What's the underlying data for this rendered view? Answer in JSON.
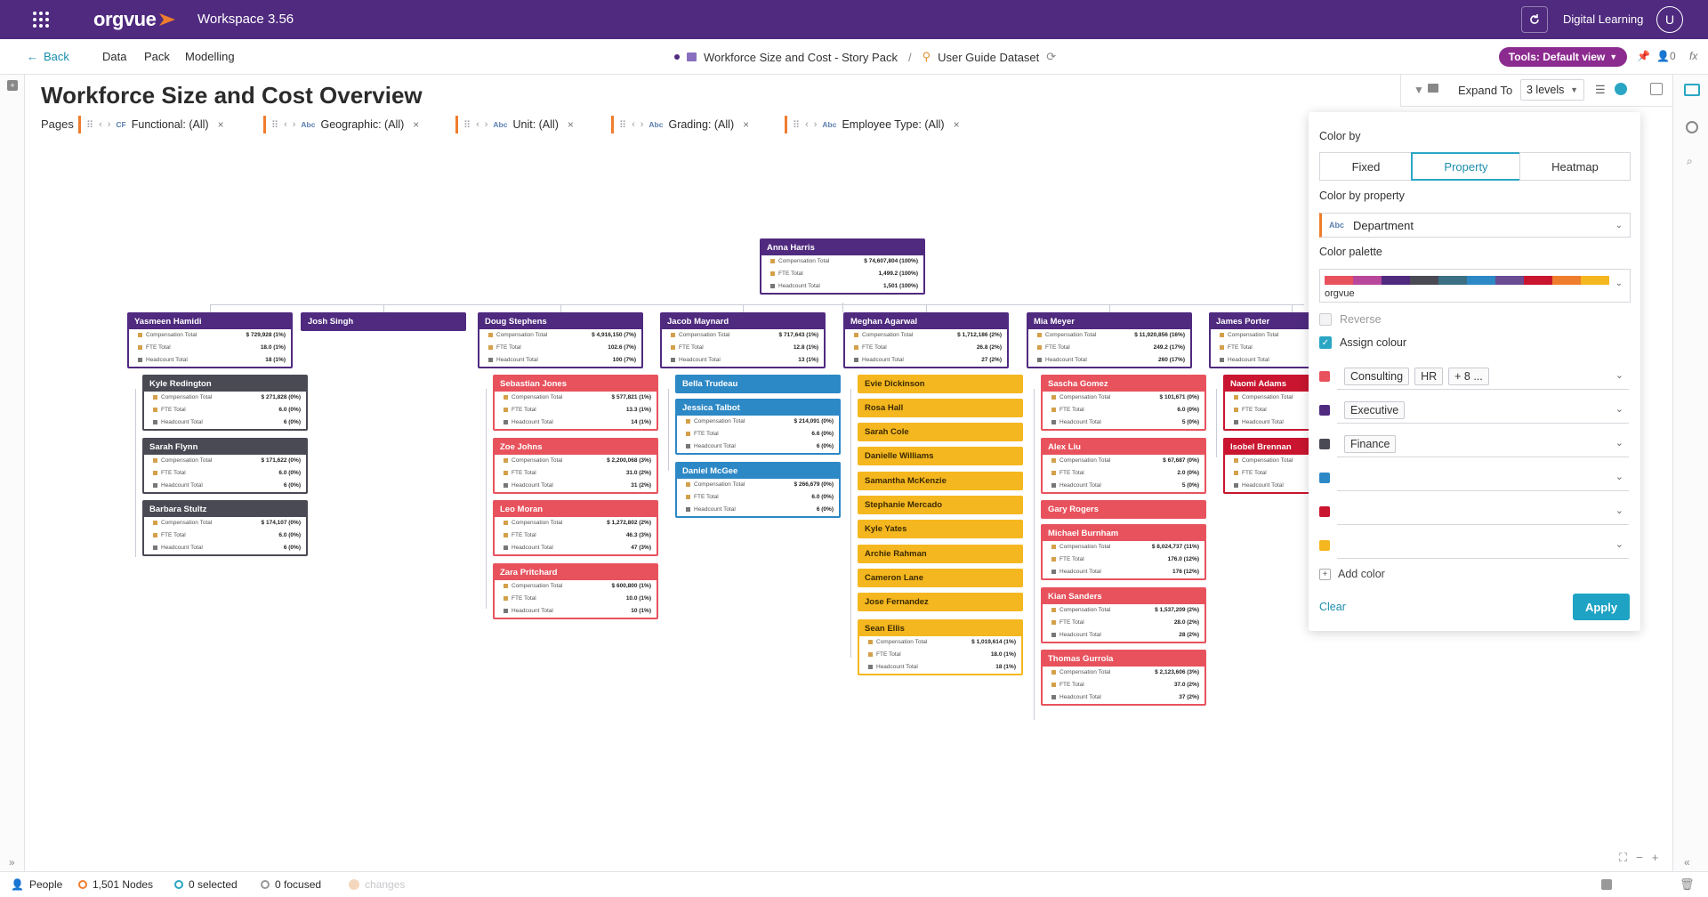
{
  "topbar": {
    "app_name": "orgvue",
    "workspace": "Workspace",
    "version": "3.56",
    "account": "Digital Learning",
    "avatar": "U"
  },
  "nav": {
    "back": "Back",
    "data": "Data",
    "pack": "Pack",
    "modelling": "Modelling",
    "story": "Workforce Size and Cost - Story Pack",
    "sep": "/",
    "dataset": "User Guide Dataset",
    "tools": "Tools: Default view",
    "tools_count": "0"
  },
  "page": {
    "title": "Workforce Size and Cost Overview",
    "pages_label": "Pages"
  },
  "filters": [
    {
      "label": "Functional: (All)",
      "type": "CF"
    },
    {
      "label": "Geographic: (All)",
      "type": "Abc"
    },
    {
      "label": "Unit: (All)",
      "type": "Abc"
    },
    {
      "label": "Grading: (All)",
      "type": "Abc"
    },
    {
      "label": "Employee Type: (All)",
      "type": "Abc"
    }
  ],
  "toolbar": {
    "expand_label": "Expand To",
    "expand_value": "3 levels"
  },
  "metric_labels": {
    "comp": "Compensation Total",
    "fte": "FTE Total",
    "head": "Headcount Total"
  },
  "colors": {
    "purple": "#4f2a7f",
    "red": "#e8525d",
    "yellow": "#f5b71f",
    "blue": "#2d88c6",
    "dark": "#4a4a55",
    "crimson": "#c9152f",
    "accent": "#2aa6c4"
  },
  "nodes": [
    {
      "name": "Anna Harris",
      "color": "purple",
      "comp": "$ 74,607,804 (100%)",
      "fte": "1,499.2 (100%)",
      "head": "1,501 (100%)"
    },
    {
      "name": "Yasmeen Hamidi",
      "color": "purple",
      "comp": "$ 729,928 (1%)",
      "fte": "18.0 (1%)",
      "head": "18 (1%)"
    },
    {
      "name": "Josh Singh",
      "color": "purple"
    },
    {
      "name": "Doug Stephens",
      "color": "purple",
      "comp": "$ 4,916,150 (7%)",
      "fte": "102.6 (7%)",
      "head": "100 (7%)"
    },
    {
      "name": "Jacob Maynard",
      "color": "purple",
      "comp": "$ 717,643 (1%)",
      "fte": "12.8 (1%)",
      "head": "13 (1%)"
    },
    {
      "name": "Meghan Agarwal",
      "color": "purple",
      "comp": "$ 1,712,186 (2%)",
      "fte": "26.8 (2%)",
      "head": "27 (2%)"
    },
    {
      "name": "Mia Meyer",
      "color": "purple",
      "comp": "$ 11,920,856 (16%)",
      "fte": "249.2 (17%)",
      "head": "260 (17%)"
    },
    {
      "name": "James Porter",
      "color": "purple",
      "comp": "",
      "fte": "",
      "head": ""
    },
    {
      "name": "Kyle Redington",
      "color": "dark",
      "comp": "$ 271,828 (0%)",
      "fte": "6.0 (0%)",
      "head": "6 (0%)"
    },
    {
      "name": "Sarah Flynn",
      "color": "dark",
      "comp": "$ 171,622 (0%)",
      "fte": "6.0 (0%)",
      "head": "6 (0%)"
    },
    {
      "name": "Barbara Stultz",
      "color": "dark",
      "comp": "$ 174,107 (0%)",
      "fte": "6.0 (0%)",
      "head": "6 (0%)"
    },
    {
      "name": "Sebastian Jones",
      "color": "red",
      "comp": "$ 577,821 (1%)",
      "fte": "13.3 (1%)",
      "head": "14 (1%)"
    },
    {
      "name": "Zoe Johns",
      "color": "red",
      "comp": "$ 2,200,068 (3%)",
      "fte": "31.0 (2%)",
      "head": "31 (2%)"
    },
    {
      "name": "Leo Moran",
      "color": "red",
      "comp": "$ 1,272,802 (2%)",
      "fte": "46.3 (3%)",
      "head": "47 (3%)"
    },
    {
      "name": "Zara Pritchard",
      "color": "red",
      "comp": "$ 600,800 (1%)",
      "fte": "10.0 (1%)",
      "head": "10 (1%)"
    },
    {
      "name": "Bella Trudeau",
      "color": "blue"
    },
    {
      "name": "Jessica Talbot",
      "color": "blue",
      "comp": "$ 214,091 (0%)",
      "fte": "6.6 (0%)",
      "head": "6 (0%)"
    },
    {
      "name": "Daniel McGee",
      "color": "blue",
      "comp": "$ 266,679 (0%)",
      "fte": "6.0 (0%)",
      "head": "6 (0%)"
    },
    {
      "name": "Evie Dickinson",
      "color": "yellow"
    },
    {
      "name": "Rosa Hall",
      "color": "yellow"
    },
    {
      "name": "Sarah Cole",
      "color": "yellow"
    },
    {
      "name": "Danielle Williams",
      "color": "yellow"
    },
    {
      "name": "Samantha McKenzie",
      "color": "yellow"
    },
    {
      "name": "Stephanie Mercado",
      "color": "yellow"
    },
    {
      "name": "Kyle Yates",
      "color": "yellow"
    },
    {
      "name": "Archie Rahman",
      "color": "yellow"
    },
    {
      "name": "Cameron Lane",
      "color": "yellow"
    },
    {
      "name": "Jose Fernandez",
      "color": "yellow"
    },
    {
      "name": "Sean Ellis",
      "color": "yellow",
      "comp": "$ 1,019,614 (1%)",
      "fte": "18.0 (1%)",
      "head": "18 (1%)"
    },
    {
      "name": "Sascha Gomez",
      "color": "red",
      "comp": "$ 101,671 (0%)",
      "fte": "6.0 (0%)",
      "head": "5 (0%)"
    },
    {
      "name": "Alex Liu",
      "color": "red",
      "comp": "$ 67,687 (0%)",
      "fte": "2.0 (0%)",
      "head": "5 (0%)"
    },
    {
      "name": "Gary Rogers",
      "color": "red"
    },
    {
      "name": "Michael Burnham",
      "color": "red",
      "comp": "$ 8,024,737 (11%)",
      "fte": "176.0 (12%)",
      "head": "176 (12%)"
    },
    {
      "name": "Kian Sanders",
      "color": "red",
      "comp": "$ 1,537,209 (2%)",
      "fte": "28.0 (2%)",
      "head": "28 (2%)"
    },
    {
      "name": "Thomas Gurrola",
      "color": "red",
      "comp": "$ 2,123,606 (3%)",
      "fte": "37.0 (2%)",
      "head": "37 (2%)"
    },
    {
      "name": "Naomi Adams",
      "color": "crimson",
      "comp": "",
      "fte": "",
      "head": ""
    },
    {
      "name": "Isobel Brennan",
      "color": "crimson",
      "comp": "",
      "fte": "",
      "head": ""
    }
  ],
  "panel": {
    "color_by": "Color by",
    "modes": [
      "Fixed",
      "Property",
      "Heatmap"
    ],
    "active_mode": "Property",
    "color_by_property": "Color by property",
    "property_type": "Abc",
    "property": "Department",
    "palette_label": "Color palette",
    "palette_name": "orgvue",
    "palette": [
      "#e8525d",
      "#b8479c",
      "#4f2a7f",
      "#4a4a55",
      "#3b6f84",
      "#2d88c6",
      "#6a4c93",
      "#c9152f",
      "#ef7d2e",
      "#f5b71f"
    ],
    "reverse": "Reverse",
    "assign": "Assign colour",
    "rows": [
      {
        "color": "#e8525d",
        "tags": [
          "Consulting",
          "HR",
          "+ 8 ..."
        ]
      },
      {
        "color": "#4f2a7f",
        "tags": [
          "Executive"
        ]
      },
      {
        "color": "#4a4a55",
        "tags": [
          "Finance"
        ]
      },
      {
        "color": "#2d88c6",
        "tags": []
      },
      {
        "color": "#c9152f",
        "tags": []
      },
      {
        "color": "#f5b71f",
        "tags": []
      }
    ],
    "add_color": "Add color",
    "clear": "Clear",
    "apply": "Apply"
  },
  "status": {
    "dataset": "People",
    "nodes": "1,501 Nodes",
    "selected": "0 selected",
    "focused": "0 focused",
    "changes": "changes"
  }
}
